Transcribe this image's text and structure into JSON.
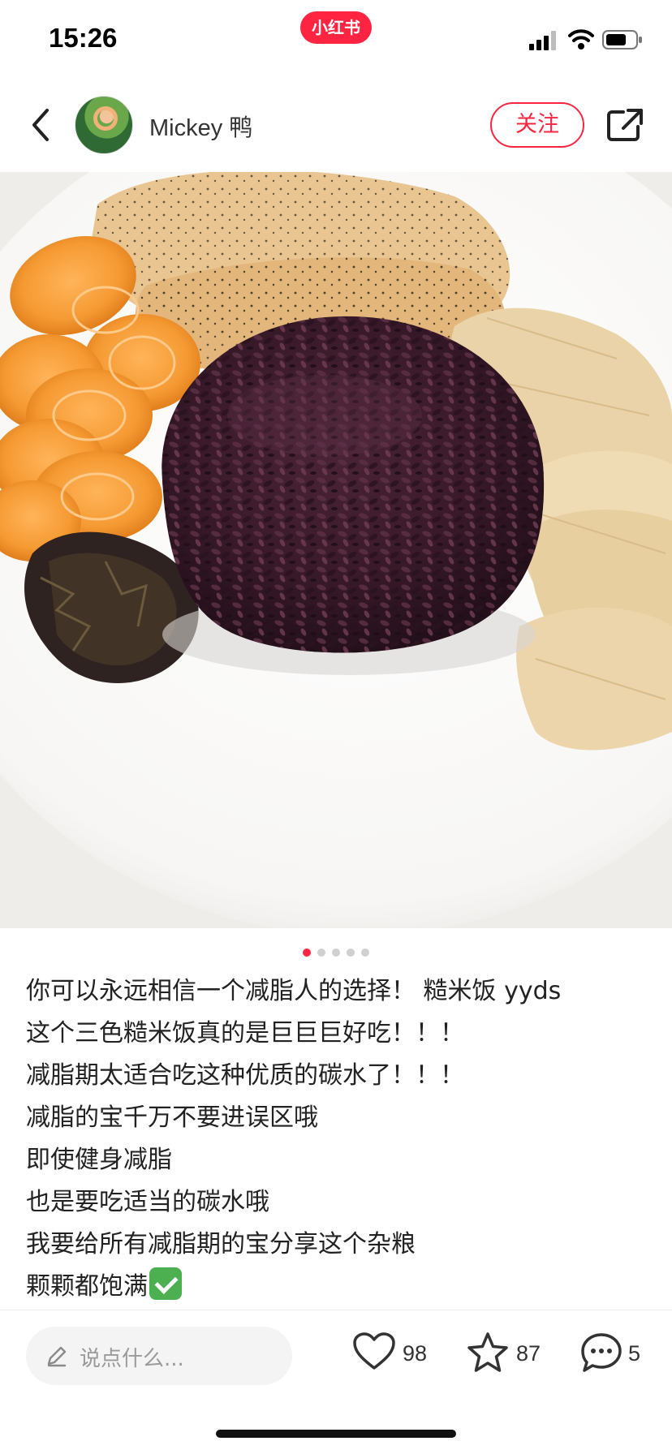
{
  "status_bar": {
    "time": "15:26",
    "brand": "小红书",
    "icons": [
      "signal-icon",
      "wifi-icon",
      "battery-icon"
    ]
  },
  "header": {
    "author": "Mickey 鸭",
    "follow_label": "关注",
    "icons": [
      "back-icon",
      "avatar",
      "share-icon"
    ]
  },
  "photo": {
    "pager": {
      "total": 5,
      "active": 1
    }
  },
  "post": {
    "lines": [
      "你可以永远相信一个减脂人的选择！ 糙米饭 yyds",
      "这个三色糙米饭真的是巨巨巨好吃！！！",
      "减脂期太适合吃这种优质的碳水了！！！",
      "减脂的宝千万不要进误区哦",
      "即使健身减脂",
      "也是要吃适当的碳水哦",
      "我要给所有减脂期的宝分享这个杂粮",
      "颗颗都饱满"
    ]
  },
  "bottom_bar": {
    "comment_placeholder": "说点什么...",
    "likes": "98",
    "favorites": "87",
    "comments": "5"
  },
  "colors": {
    "brand_red": "#ff2442",
    "text": "#222222",
    "muted": "#9a9a9a"
  }
}
